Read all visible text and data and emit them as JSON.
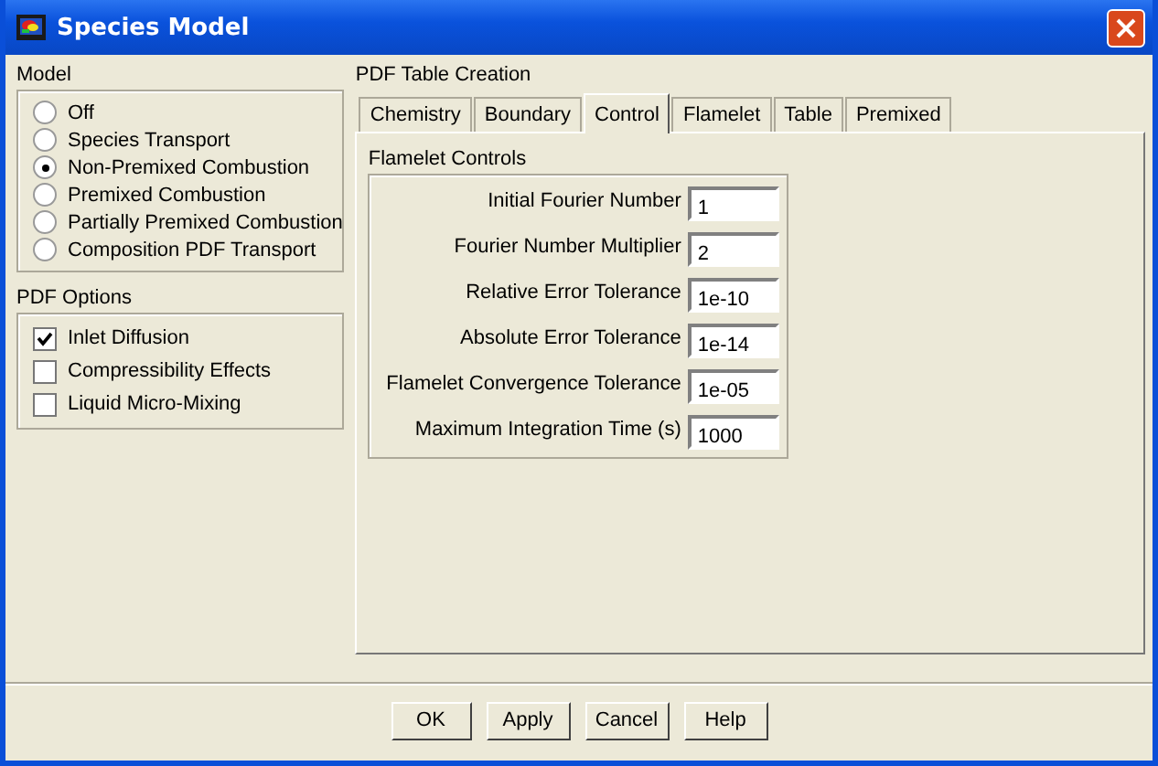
{
  "window": {
    "title": "Species Model"
  },
  "model": {
    "title": "Model",
    "options": [
      {
        "label": "Off",
        "selected": false
      },
      {
        "label": "Species Transport",
        "selected": false
      },
      {
        "label": "Non-Premixed Combustion",
        "selected": true
      },
      {
        "label": "Premixed Combustion",
        "selected": false
      },
      {
        "label": "Partially Premixed Combustion",
        "selected": false
      },
      {
        "label": "Composition PDF Transport",
        "selected": false
      }
    ]
  },
  "pdf_options": {
    "title": "PDF Options",
    "options": [
      {
        "label": "Inlet Diffusion",
        "checked": true
      },
      {
        "label": "Compressibility Effects",
        "checked": false
      },
      {
        "label": "Liquid Micro-Mixing",
        "checked": false
      }
    ]
  },
  "pdf_table": {
    "title": "PDF Table Creation",
    "tabs": [
      {
        "label": "Chemistry",
        "selected": false
      },
      {
        "label": "Boundary",
        "selected": false
      },
      {
        "label": "Control",
        "selected": true
      },
      {
        "label": "Flamelet",
        "selected": false
      },
      {
        "label": "Table",
        "selected": false
      },
      {
        "label": "Premixed",
        "selected": false
      }
    ],
    "group_title": "Flamelet Controls",
    "fields": [
      {
        "label": "Initial Fourier Number",
        "value": "1"
      },
      {
        "label": "Fourier Number Multiplier",
        "value": "2"
      },
      {
        "label": "Relative Error Tolerance",
        "value": "1e-10"
      },
      {
        "label": "Absolute Error Tolerance",
        "value": "1e-14"
      },
      {
        "label": "Flamelet Convergence Tolerance",
        "value": "1e-05"
      },
      {
        "label": "Maximum Integration Time (s)",
        "value": "1000"
      }
    ]
  },
  "buttons": [
    "OK",
    "Apply",
    "Cancel",
    "Help"
  ]
}
